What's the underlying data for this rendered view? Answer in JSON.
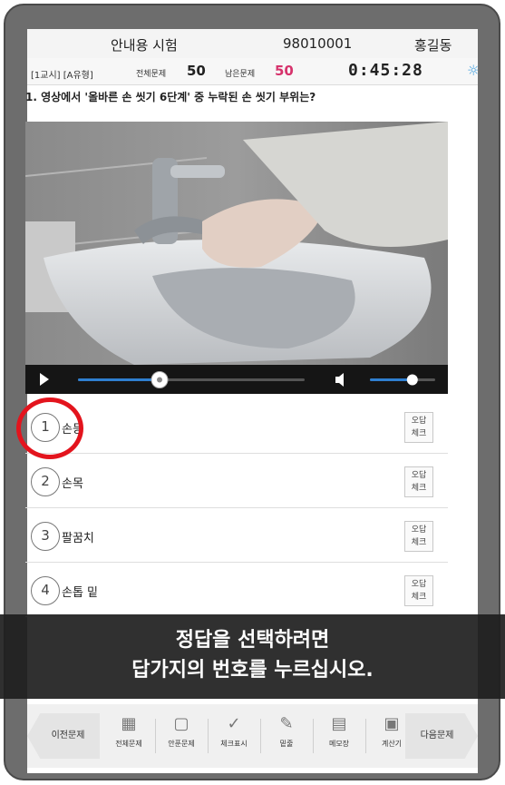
{
  "header": {
    "exam_title": "안내용 시험",
    "exam_id": "98010001",
    "user_name": "홍길동",
    "session": "[1교시] [A유형]",
    "total_label": "전체문제",
    "total_count": "50",
    "remaining_label": "남은문제",
    "remaining_count": "50",
    "timer": "0:45:28",
    "colors": {
      "remaining": "#d6336c",
      "timer": "#222222",
      "sun": "#4aa3df"
    }
  },
  "question": {
    "text": "1. 영상에서 '올바른 손 씻기 6단계' 중 누락된 손 씻기 부위는?"
  },
  "video": {
    "progress": 0.36,
    "volume": 0.65
  },
  "options": [
    {
      "number": "1",
      "label": "손등",
      "check_line1": "오답",
      "check_line2": "체크"
    },
    {
      "number": "2",
      "label": "손목",
      "check_line1": "오답",
      "check_line2": "체크"
    },
    {
      "number": "3",
      "label": "팔꿈치",
      "check_line1": "오답",
      "check_line2": "체크"
    },
    {
      "number": "4",
      "label": "손톱 밑",
      "check_line1": "오답",
      "check_line2": "체크"
    }
  ],
  "banner": {
    "line1": "정답을 선택하려면",
    "line2": "답가지의 번호를 누르십시오."
  },
  "toolbar": {
    "prev": "이전문제",
    "next": "다음문제",
    "items": [
      {
        "label": "전체문제",
        "icon": "grid-icon"
      },
      {
        "label": "안푼문제",
        "icon": "empty-grid-icon"
      },
      {
        "label": "체크표시",
        "icon": "checkmark-icon"
      },
      {
        "label": "밑줄",
        "icon": "pen-underline-icon"
      },
      {
        "label": "메모장",
        "icon": "memo-icon"
      },
      {
        "label": "계산기",
        "icon": "calculator-icon"
      }
    ]
  }
}
